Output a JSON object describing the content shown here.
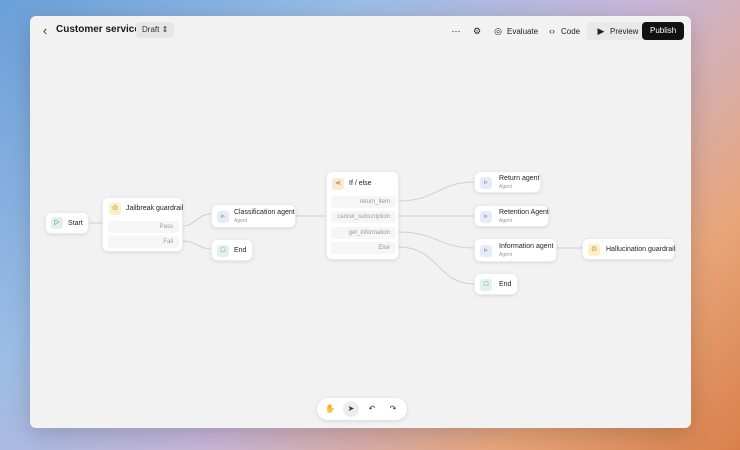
{
  "header": {
    "title": "Customer service",
    "status": "Draft",
    "evaluate_label": "Evaluate",
    "code_label": "Code",
    "preview_label": "Preview",
    "publish_label": "Publish"
  },
  "nodes": {
    "start": {
      "label": "Start"
    },
    "jailbreak": {
      "label": "Jailbreak guardrail",
      "outputs": [
        "Pass",
        "Fail"
      ]
    },
    "classification": {
      "label": "Classification agent",
      "sub": "Agent"
    },
    "end1": {
      "label": "End"
    },
    "ifelse": {
      "label": "If / else",
      "conditions": [
        "return_item",
        "cancel_subscription",
        "get_information",
        "Else"
      ]
    },
    "return_agent": {
      "label": "Return agent",
      "sub": "Agent"
    },
    "retention_agent": {
      "label": "Retention Agent",
      "sub": "Agent"
    },
    "information_agent": {
      "label": "Information agent",
      "sub": "Agent"
    },
    "end2": {
      "label": "End"
    },
    "hallucination": {
      "label": "Hallucination guardrail"
    }
  },
  "toolbar": {
    "icons": [
      "hand-icon",
      "pointer-icon",
      "undo-icon",
      "redo-icon"
    ]
  },
  "colors": {
    "publish_bg": "#111111",
    "canvas_bg": "#f2f2f2"
  }
}
